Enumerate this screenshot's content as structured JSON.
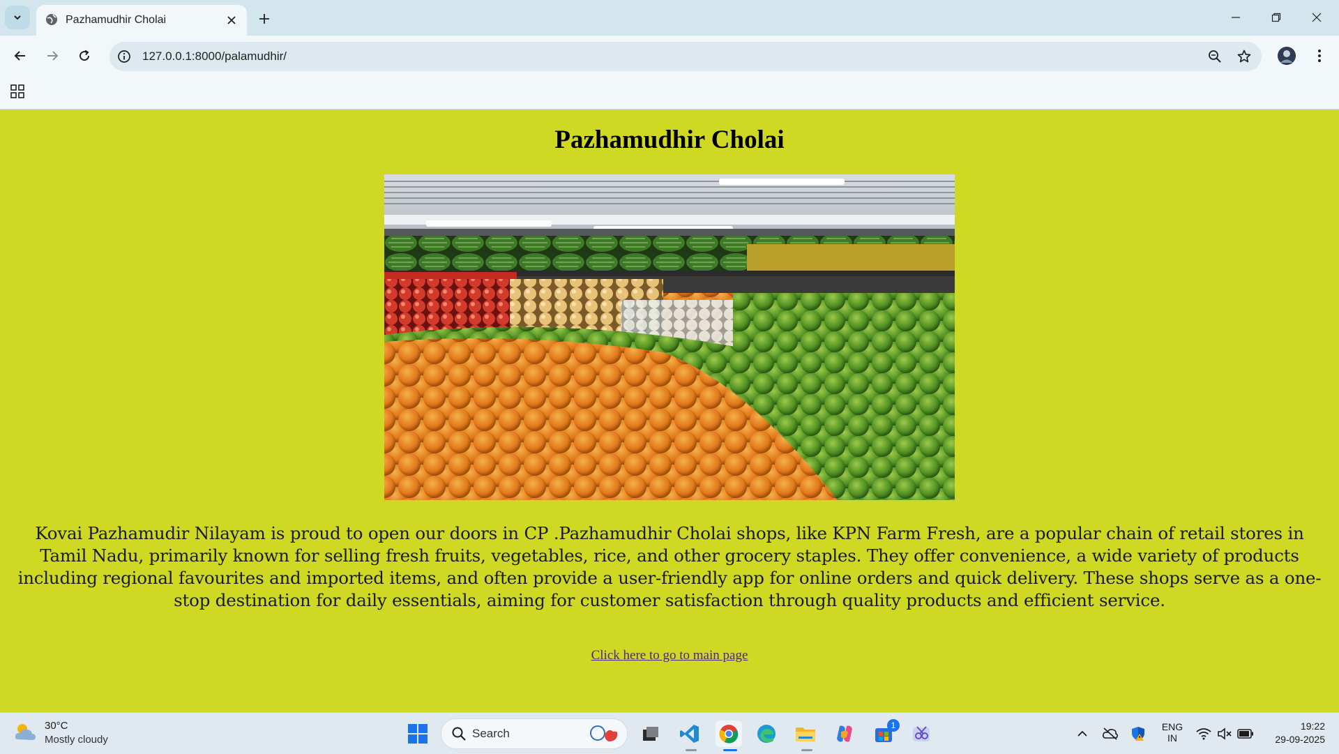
{
  "browser": {
    "tab_title": "Pazhamudhir Cholai",
    "url": "127.0.0.1:8000/palamudhir/"
  },
  "page": {
    "title": "Pazhamudhir Cholai",
    "image_alt": "Fruit shop shelves stacked with oranges, apples, melons and mangoes",
    "description": "Kovai Pazhamudir Nilayam is proud to open our doors in CP .Pazhamudhir Cholai shops, like KPN Farm Fresh, are a popular chain of retail stores in Tamil Nadu, primarily known for selling fresh fruits, vegetables, rice, and other grocery staples. They offer convenience, a wide variety of products including regional favourites and imported items, and often provide a user-friendly app for online orders and quick delivery. These shops serve as a one-stop destination for daily essentials, aiming for customer satisfaction through quality products and efficient service.",
    "link_text": "Click here to go to main page",
    "background_color": "#cfd923"
  },
  "taskbar": {
    "weather_temp": "30°C",
    "weather_condition": "Mostly cloudy",
    "search_placeholder": "Search",
    "language": "ENG",
    "region": "IN",
    "time": "19:22",
    "date": "29-09-2025",
    "store_badge": "1"
  }
}
